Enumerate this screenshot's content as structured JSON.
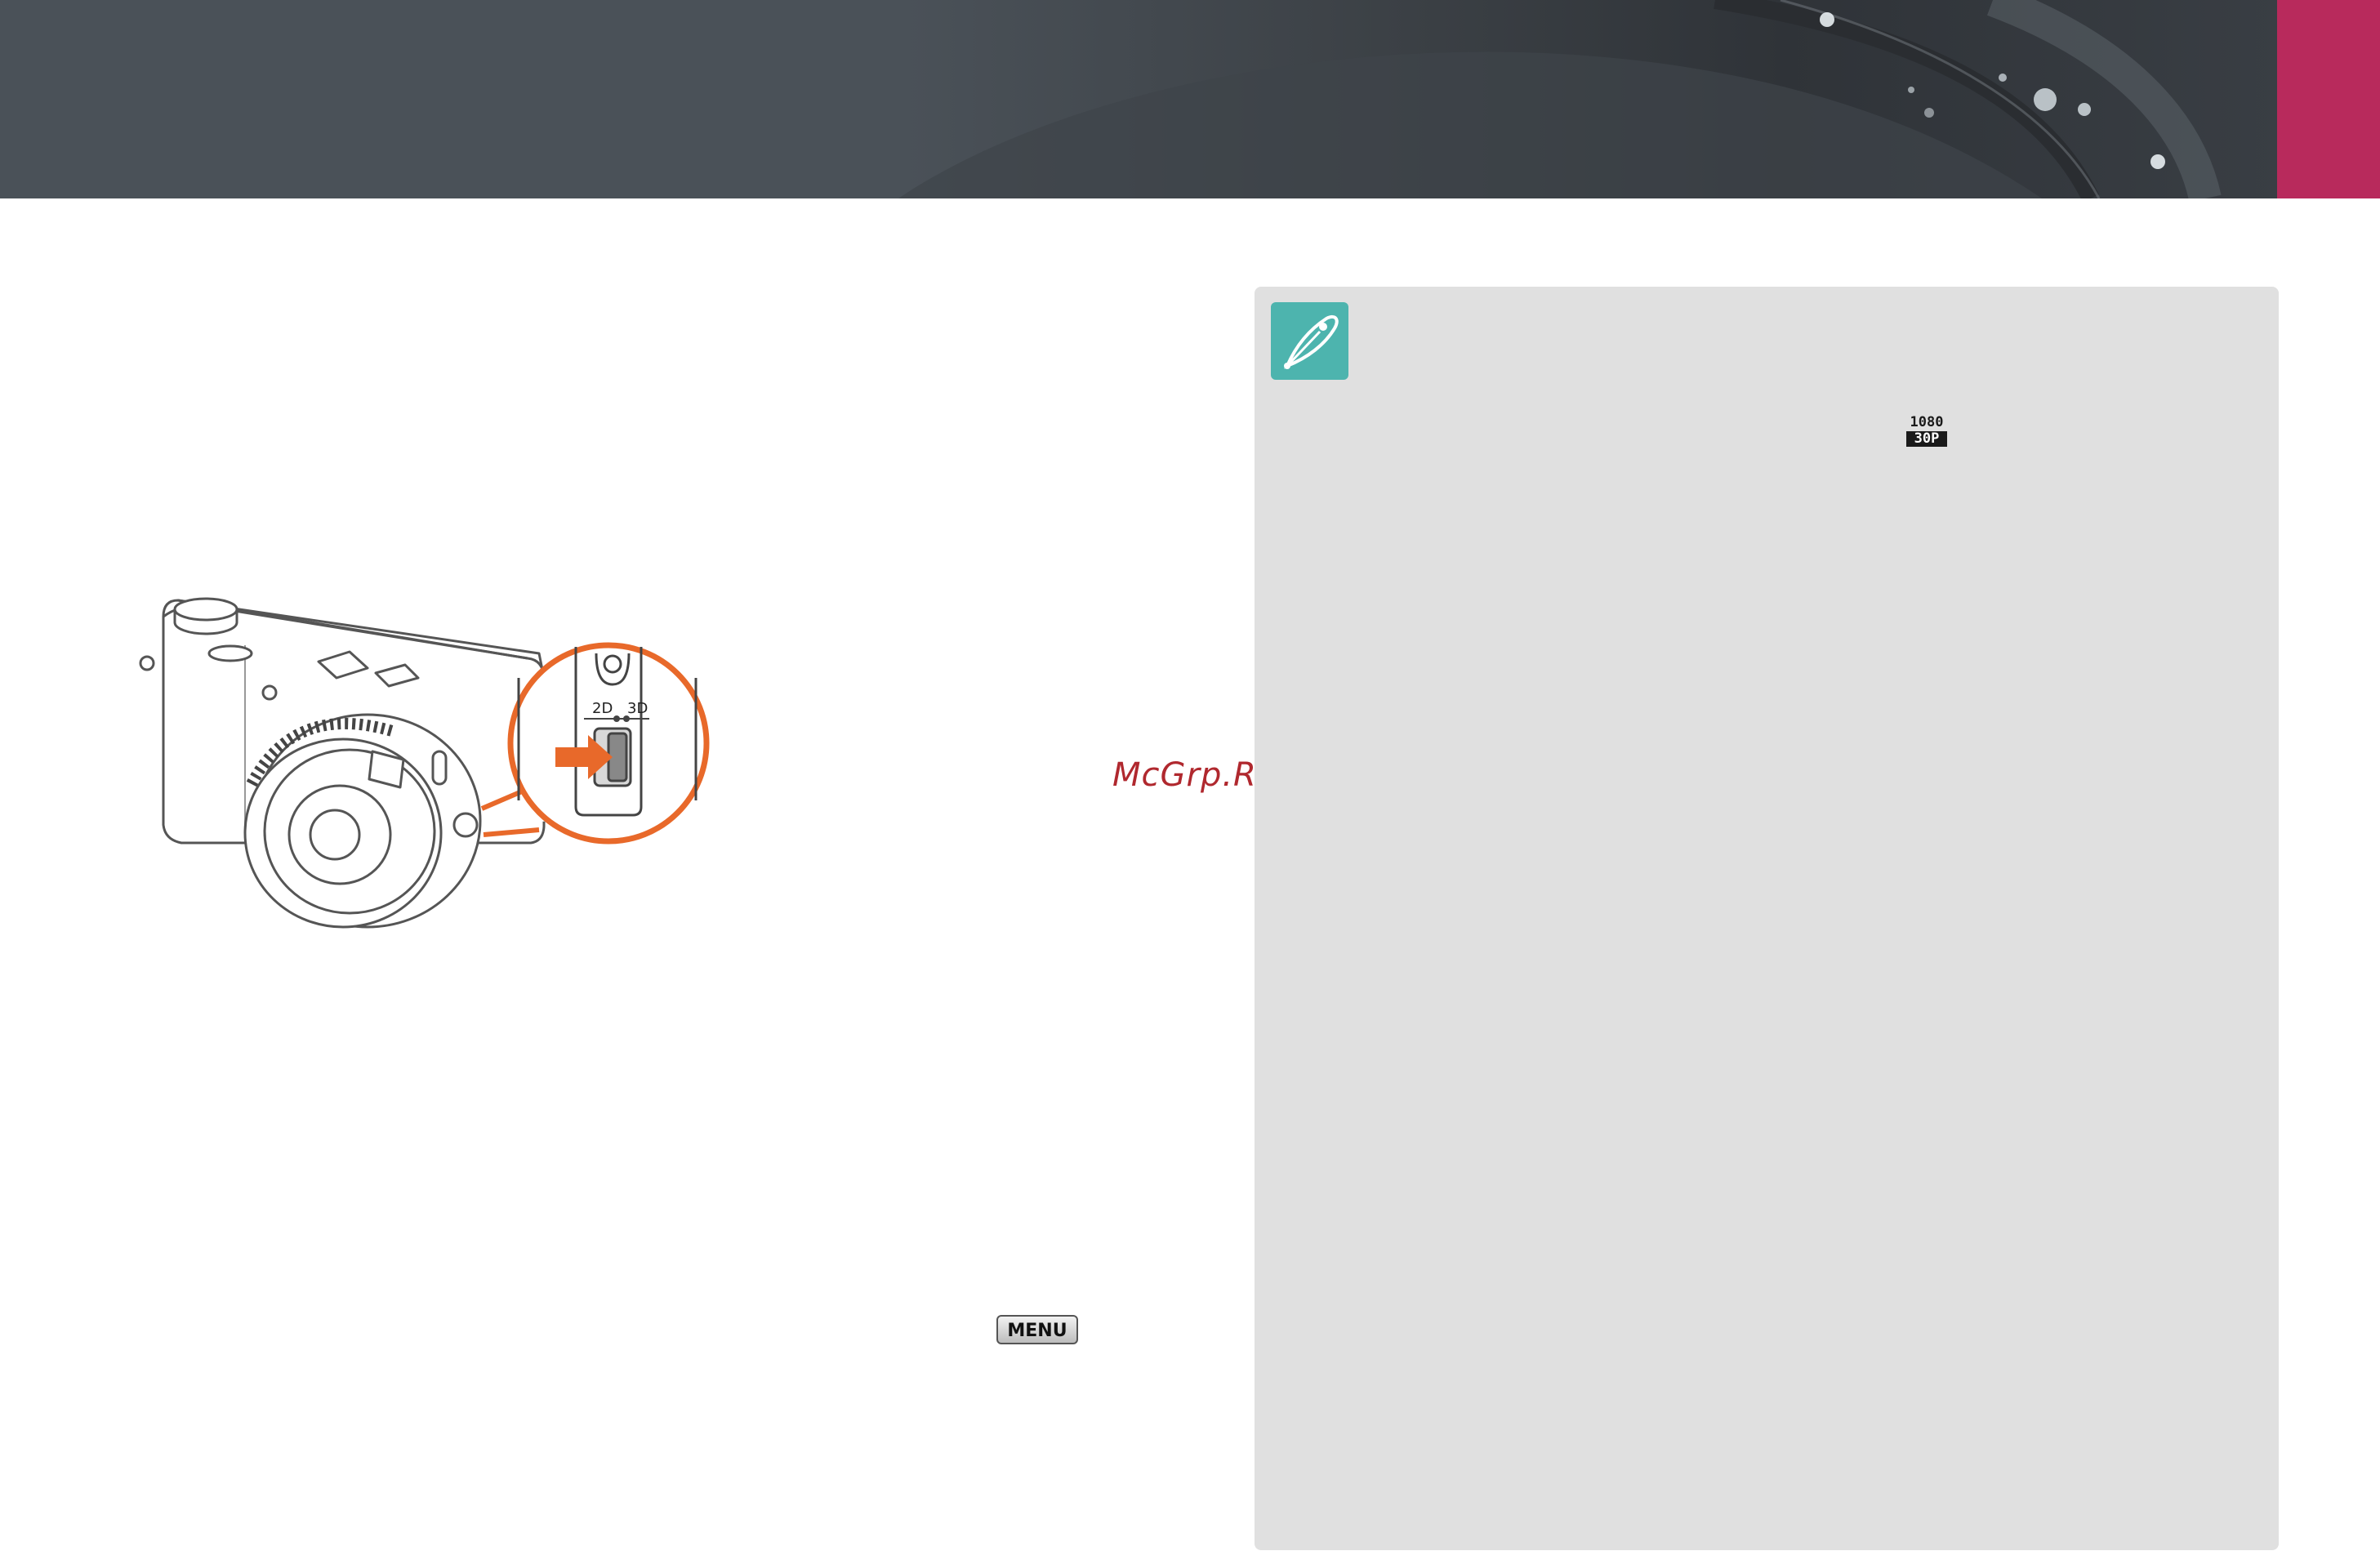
{
  "header": {
    "accent_color": "#b82a5c"
  },
  "note": {
    "icon": "pen-nib-icon",
    "panel_color": "#e0e0e0",
    "icon_color": "#4db4ae"
  },
  "resolution_icon": {
    "top": "1080",
    "bottom": "30P"
  },
  "illustration": {
    "icon": "camera-3d-switch-illustration",
    "switch_label_2d": "2D",
    "switch_label_3d": "3D",
    "highlight_color": "#e8692a"
  },
  "watermark": "McGrp.Ru",
  "menu_button": "MENU"
}
